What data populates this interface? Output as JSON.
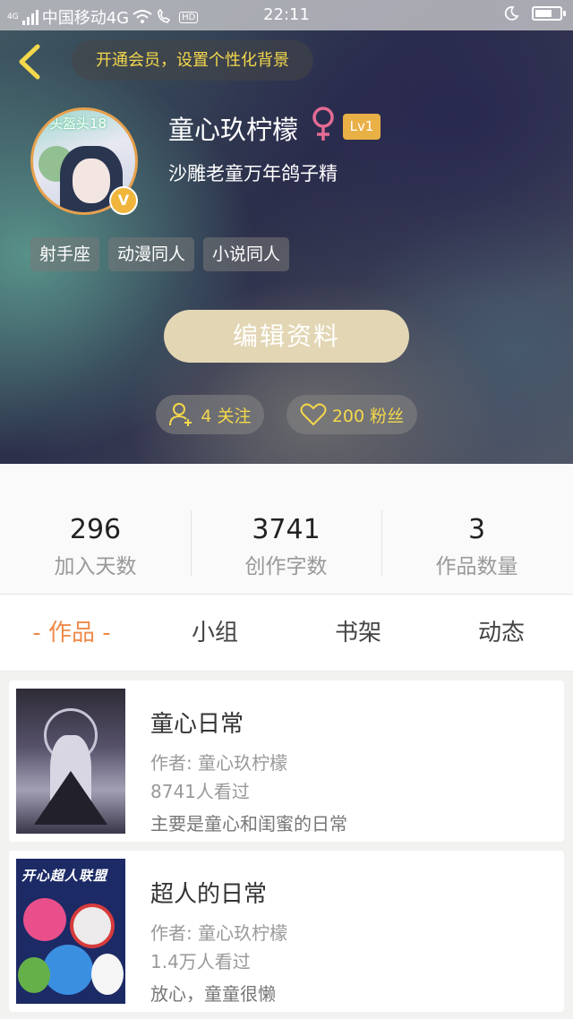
{
  "status_bar": {
    "network_tag": "4G",
    "carrier": "中国移动4G",
    "hd_tag": "HD",
    "time": "22:11"
  },
  "header": {
    "vip_banner": "开通会员，设置个性化背景"
  },
  "profile": {
    "avatar_caption": "头盔头18",
    "vip_badge": "V",
    "username": "童心玖柠檬",
    "gender_symbol": "♀",
    "gender_color": "#e46b93",
    "level": "Lv1",
    "bio": "沙雕老童万年鸽子精",
    "tags": [
      "射手座",
      "动漫同人",
      "小说同人"
    ],
    "edit_button": "编辑资料",
    "following": "4 关注",
    "fans": "200 粉丝"
  },
  "stats": [
    {
      "value": "296",
      "label": "加入天数"
    },
    {
      "value": "3741",
      "label": "创作字数"
    },
    {
      "value": "3",
      "label": "作品数量"
    }
  ],
  "tabs": [
    {
      "label": "- 作品 -",
      "active": true
    },
    {
      "label": "小组",
      "active": false
    },
    {
      "label": "书架",
      "active": false
    },
    {
      "label": "动态",
      "active": false
    }
  ],
  "works": [
    {
      "title": "童心日常",
      "author": "作者: 童心玖柠檬",
      "views": "8741人看过",
      "desc": "主要是童心和闺蜜的日常"
    },
    {
      "title": "超人的日常",
      "cover_text": "开心超人联盟",
      "author": "作者: 童心玖柠檬",
      "views": "1.4万人看过",
      "desc": "放心，童童很懒"
    }
  ],
  "colors": {
    "accent": "#ef8a4a",
    "gold": "#f4d84c",
    "edit_button": "#e3d6b4",
    "level_badge": "#e9b046"
  }
}
